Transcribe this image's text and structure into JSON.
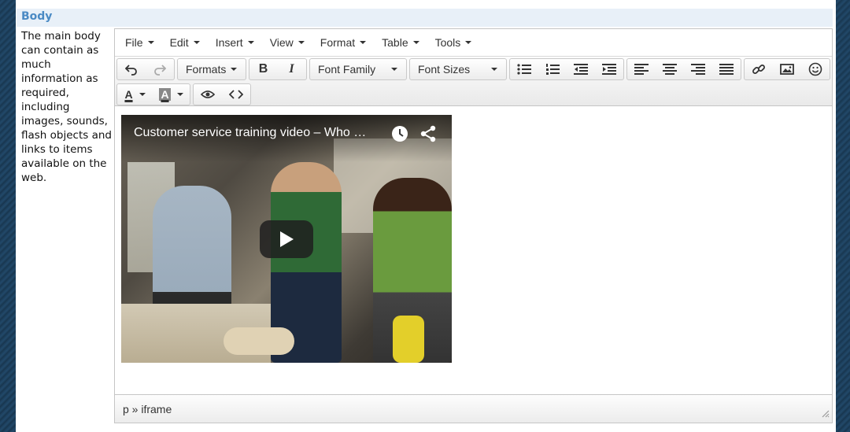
{
  "section": {
    "header": "Body"
  },
  "description": "The main body can contain as much information as required, including images, sounds, flash objects and links to items available on the web.",
  "menubar": {
    "items": [
      {
        "label": "File"
      },
      {
        "label": "Edit"
      },
      {
        "label": "Insert"
      },
      {
        "label": "View"
      },
      {
        "label": "Format"
      },
      {
        "label": "Table"
      },
      {
        "label": "Tools"
      }
    ]
  },
  "toolbar": {
    "formats_label": "Formats",
    "bold_label": "B",
    "italic_label": "I",
    "font_family_label": "Font Family",
    "font_sizes_label": "Font Sizes",
    "text_color_label": "A",
    "bg_color_label": "A",
    "icons": [
      "undo-icon",
      "redo-icon",
      "bullet-list-icon",
      "numbered-list-icon",
      "outdent-icon",
      "indent-icon",
      "align-left-icon",
      "align-center-icon",
      "align-right-icon",
      "justify-icon",
      "link-icon",
      "image-icon",
      "emoticon-icon",
      "preview-icon",
      "code-icon"
    ]
  },
  "video": {
    "title": "Customer service training video – Who …",
    "icons": [
      "clock-icon",
      "share-icon",
      "play-icon"
    ]
  },
  "statusbar": {
    "path": "p » iframe"
  },
  "colors": {
    "accent": "#4a8ac4",
    "header_bg": "#e8f0f8",
    "frame": "#1d3a52"
  }
}
